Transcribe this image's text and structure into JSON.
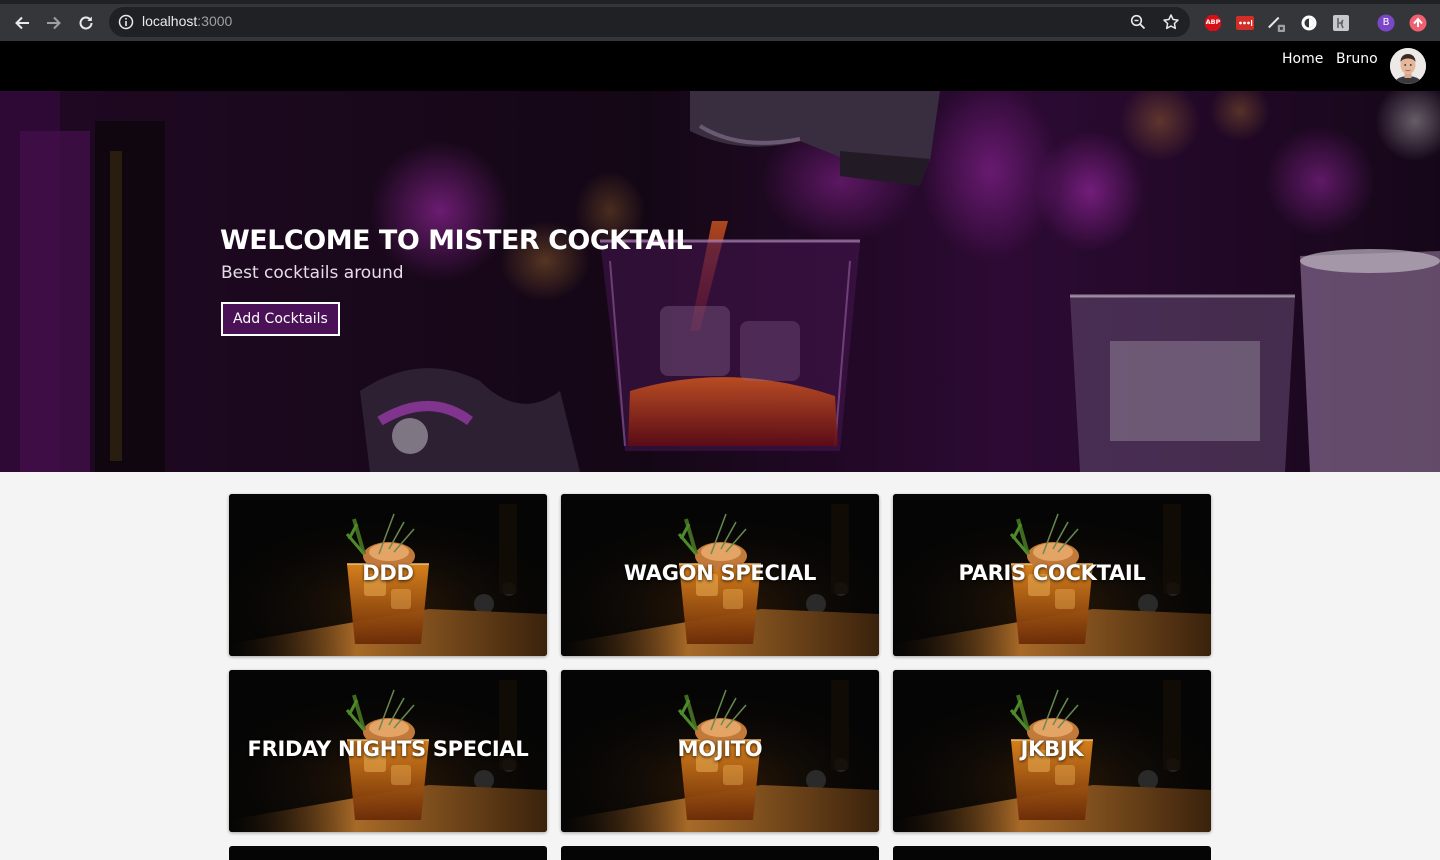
{
  "browser": {
    "url_host": "localhost",
    "url_port": ":3000",
    "profile_initial": "B",
    "ext_abp_label": "ABP"
  },
  "nav": {
    "links": [
      "Home",
      "Bruno"
    ]
  },
  "hero": {
    "title": "WELCOME TO MISTER COCKTAIL",
    "subtitle": "Best cocktails around",
    "button_label": "Add Cocktails"
  },
  "cocktails": [
    {
      "name": "DDD"
    },
    {
      "name": "WAGON SPECIAL"
    },
    {
      "name": "PARIS COCKTAIL"
    },
    {
      "name": "FRIDAY NIGHTS SPECIAL"
    },
    {
      "name": "MOJITO"
    },
    {
      "name": "JKBJK"
    }
  ],
  "colors": {
    "navbar": "#000000",
    "page_bg": "#f4f4f4",
    "button_bg": "#4a1156",
    "hero_accent": "#b21fc4"
  }
}
